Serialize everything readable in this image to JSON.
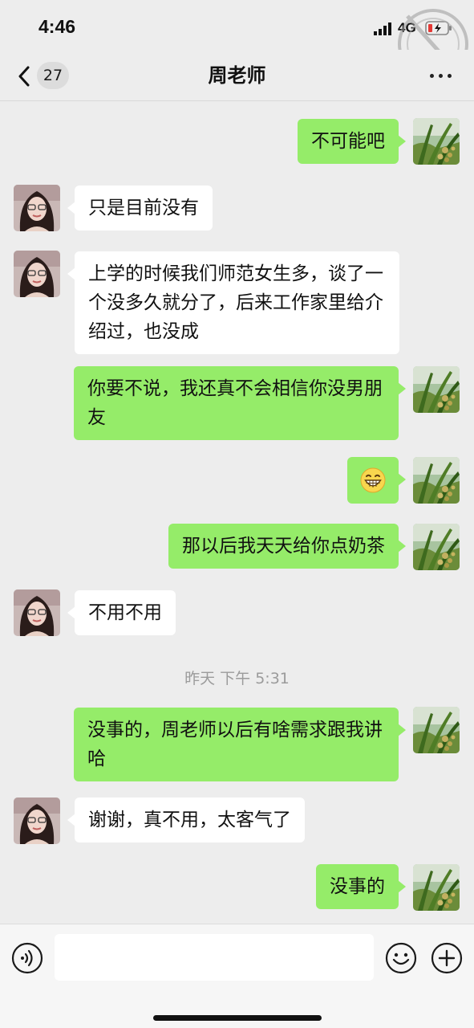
{
  "status_bar": {
    "time": "4:46",
    "network": "4G"
  },
  "header": {
    "back_count": "27",
    "title": "周老师"
  },
  "messages": [
    {
      "side": "right",
      "text": "不可能吧"
    },
    {
      "side": "left",
      "text": "只是目前没有"
    },
    {
      "side": "left",
      "text": "上学的时候我们师范女生多，谈了一个没多久就分了，后来工作家里给介绍过，也没成"
    },
    {
      "side": "right",
      "text": "你要不说，我还真不会相信你没男朋友"
    },
    {
      "side": "right",
      "emoji": "grinning-face"
    },
    {
      "side": "right",
      "text": "那以后我天天给你点奶茶"
    },
    {
      "side": "left",
      "text": "不用不用"
    },
    {
      "side": "right",
      "text": "没事的，周老师以后有啥需求跟我讲哈"
    },
    {
      "side": "left",
      "text": "谢谢，真不用，太客气了"
    },
    {
      "side": "right",
      "text": "没事的"
    }
  ],
  "time_divider": "昨天 下午 5:31",
  "input_bar": {
    "text": ""
  },
  "colors": {
    "background": "#ededed",
    "sent_bubble": "#95ec69",
    "received_bubble": "#ffffff",
    "system_text": "#9b9b9b"
  }
}
